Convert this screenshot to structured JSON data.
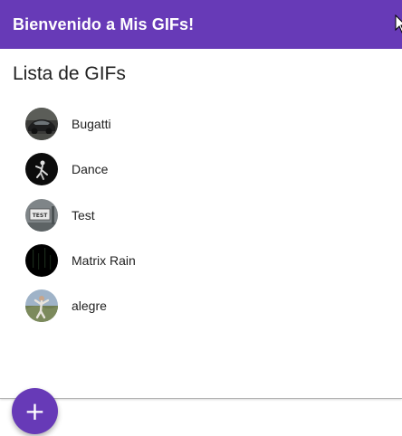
{
  "toolbar": {
    "title": "Bienvenido a Mis GIFs!",
    "background": "#673ab7"
  },
  "main": {
    "title": "Lista de GIFs",
    "items": [
      {
        "label": "Bugatti",
        "thumbnail": "car-thumbnail"
      },
      {
        "label": "Dance",
        "thumbnail": "dancer-thumbnail"
      },
      {
        "label": "Test",
        "thumbnail": "test-sign-thumbnail"
      },
      {
        "label": "Matrix Rain",
        "thumbnail": "matrix-rain-thumbnail"
      },
      {
        "label": "alegre",
        "thumbnail": "person-outdoor-thumbnail"
      }
    ]
  },
  "fab": {
    "icon": "plus-icon",
    "glyph": "+",
    "color": "#673ab7"
  }
}
